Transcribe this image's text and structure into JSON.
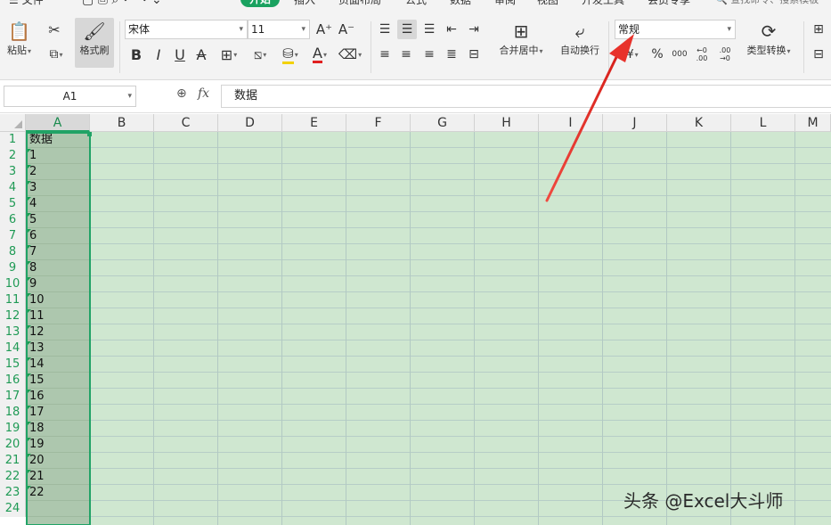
{
  "menu": {
    "file": "☰ 文件",
    "active_tab": "开始",
    "tabs": [
      "插入",
      "页面布局",
      "公式",
      "数据",
      "审阅",
      "视图",
      "开发工具",
      "会员专享"
    ],
    "search": "🔍 查找命令、搜索模板"
  },
  "ribbon": {
    "paste": "粘贴",
    "format_painter": "格式刷",
    "font_name": "宋体",
    "font_size": "11",
    "merge_center": "合并居中",
    "wrap_text": "自动换行",
    "number_format": "常规",
    "type_convert": "类型转换",
    "percent": "%",
    "thousands": "000",
    "inc_decimal": "←0 .00",
    "dec_decimal": ".00 →0"
  },
  "formula_bar": {
    "name_box": "A1",
    "fx": "fx",
    "value": "数据"
  },
  "grid": {
    "columns": [
      "A",
      "B",
      "C",
      "D",
      "E",
      "F",
      "G",
      "H",
      "I",
      "J",
      "K",
      "L",
      "M"
    ],
    "rows": [
      "1",
      "2",
      "3",
      "4",
      "5",
      "6",
      "7",
      "8",
      "9",
      "10",
      "11",
      "12",
      "13",
      "14",
      "15",
      "16",
      "17",
      "18",
      "19",
      "20",
      "21",
      "22",
      "23",
      "24"
    ],
    "colA_values": [
      "数据",
      "1",
      "2",
      "3",
      "4",
      "5",
      "6",
      "7",
      "8",
      "9",
      "10",
      "11",
      "12",
      "13",
      "14",
      "15",
      "16",
      "17",
      "18",
      "19",
      "20",
      "21",
      "22"
    ]
  },
  "annotation": {
    "arrow_color": "#e8322b",
    "watermark": "头条 @Excel大斗师"
  },
  "colors": {
    "accent": "#21a366",
    "grid_bg": "#cfe7d0",
    "selected_col": "#adc7ae"
  }
}
